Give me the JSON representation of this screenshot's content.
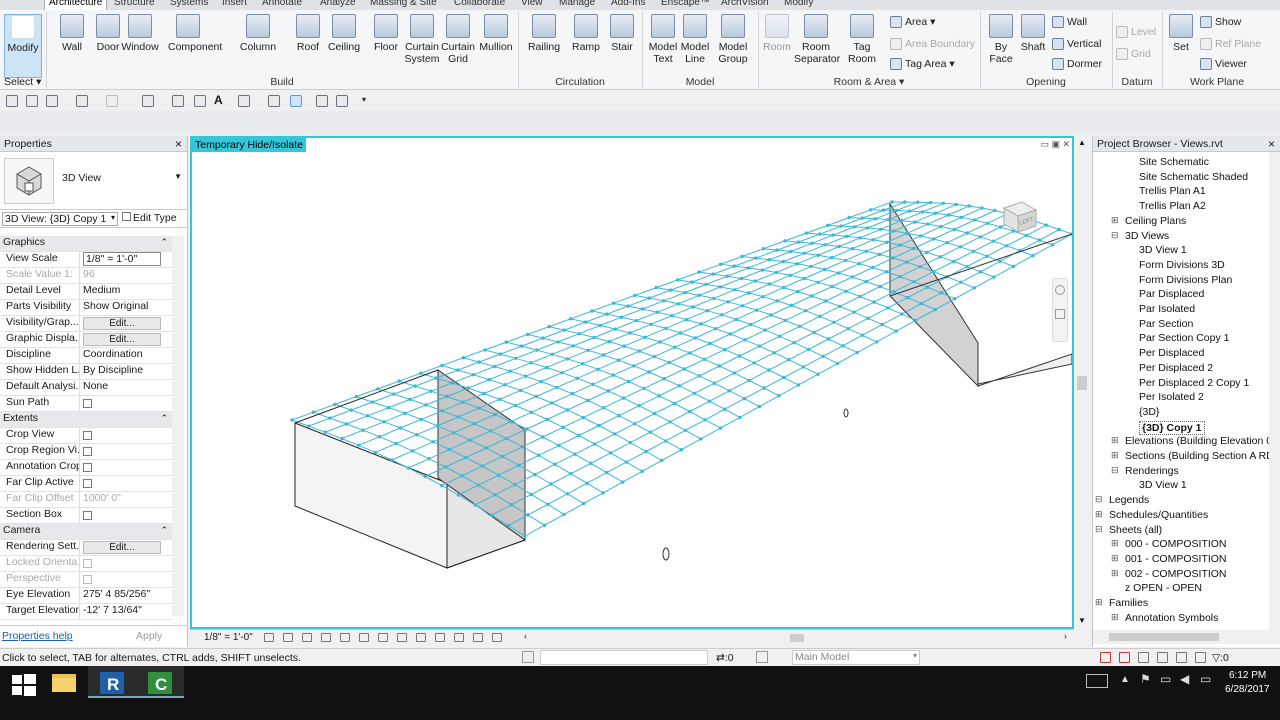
{
  "ribbon_tabs": [
    "Architecture",
    "Structure",
    "Systems",
    "Insert",
    "Annotate",
    "Analyze",
    "Massing & Site",
    "Collaborate",
    "View",
    "Manage",
    "Add-Ins",
    "Enscape™",
    "ArchVision",
    "Modify"
  ],
  "ribbon": {
    "modify": "Modify",
    "select": "Select ▾",
    "build": {
      "label": "Build",
      "items": [
        "Wall",
        "Door",
        "Window",
        "Component",
        "Column",
        "Roof",
        "Ceiling",
        "Floor",
        "Curtain System",
        "Curtain Grid",
        "Mullion"
      ]
    },
    "circulation": {
      "label": "Circulation",
      "items": [
        "Railing",
        "Ramp",
        "Stair"
      ]
    },
    "model": {
      "label": "Model",
      "items": [
        "Model Text",
        "Model Line",
        "Model Group"
      ]
    },
    "room_area": {
      "label": "Room & Area ▾",
      "items": [
        "Room",
        "Room Separator",
        "Tag Room"
      ],
      "small": [
        "Area ▾",
        "Area Boundary",
        "Tag Area ▾"
      ]
    },
    "opening": {
      "label": "Opening",
      "items": [
        "By Face",
        "Shaft"
      ],
      "small": [
        "Wall",
        "Vertical",
        "Dormer"
      ]
    },
    "datum": {
      "label": "Datum",
      "small": [
        "Level",
        "Grid"
      ]
    },
    "work_plane": {
      "label": "Work Plane",
      "items": [
        "Set"
      ],
      "small": [
        "Show",
        "Ref Plane",
        "Viewer"
      ]
    }
  },
  "properties": {
    "title": "Properties",
    "type_name": "3D View",
    "view_selector": "3D View: {3D} Copy 1",
    "edit_type": "Edit Type",
    "groups": [
      {
        "name": "Graphics",
        "rows": [
          {
            "k": "View Scale",
            "v": "1/8\" = 1'-0\"",
            "t": "input"
          },
          {
            "k": "Scale Value   1:",
            "v": "96",
            "dis": true
          },
          {
            "k": "Detail Level",
            "v": "Medium"
          },
          {
            "k": "Parts Visibility",
            "v": "Show Original"
          },
          {
            "k": "Visibility/Grap...",
            "v": "Edit...",
            "t": "btn"
          },
          {
            "k": "Graphic Displa...",
            "v": "Edit...",
            "t": "btn"
          },
          {
            "k": "Discipline",
            "v": "Coordination"
          },
          {
            "k": "Show Hidden L...",
            "v": "By Discipline"
          },
          {
            "k": "Default Analysi...",
            "v": "None"
          },
          {
            "k": "Sun Path",
            "v": "",
            "t": "cb"
          }
        ]
      },
      {
        "name": "Extents",
        "rows": [
          {
            "k": "Crop View",
            "v": "",
            "t": "cb"
          },
          {
            "k": "Crop Region Vi...",
            "v": "",
            "t": "cb"
          },
          {
            "k": "Annotation Crop",
            "v": "",
            "t": "cb"
          },
          {
            "k": "Far Clip Active",
            "v": "",
            "t": "cb"
          },
          {
            "k": "Far Clip Offset",
            "v": "1000'  0\"",
            "dis": true
          },
          {
            "k": "Section Box",
            "v": "",
            "t": "cb"
          }
        ]
      },
      {
        "name": "Camera",
        "rows": [
          {
            "k": "Rendering Sett...",
            "v": "Edit...",
            "t": "btn"
          },
          {
            "k": "Locked Orienta...",
            "v": "",
            "t": "cb",
            "dis": true
          },
          {
            "k": "Perspective",
            "v": "",
            "t": "cb",
            "dis": true
          },
          {
            "k": "Eye Elevation",
            "v": "275'  4 85/256\""
          },
          {
            "k": "Target Elevation",
            "v": "-12'  7 13/64\""
          }
        ]
      }
    ],
    "help": "Properties help",
    "apply": "Apply"
  },
  "viewport": {
    "label": "Temporary Hide/Isolate",
    "scale": "1/8\" = 1'-0\""
  },
  "project_browser": {
    "title": "Project Browser - Views.rvt",
    "nodes": [
      {
        "t": "Site Schematic",
        "d": 3
      },
      {
        "t": "Site Schematic Shaded",
        "d": 3
      },
      {
        "t": "Trellis Plan A1",
        "d": 3
      },
      {
        "t": "Trellis Plan A2",
        "d": 3
      },
      {
        "t": "Ceiling Plans",
        "d": 2,
        "ex": "⊞"
      },
      {
        "t": "3D Views",
        "d": 2,
        "ex": "⊟"
      },
      {
        "t": "3D View 1",
        "d": 3
      },
      {
        "t": "Form Divisions 3D",
        "d": 3
      },
      {
        "t": "Form Divisions Plan",
        "d": 3
      },
      {
        "t": "Par Displaced",
        "d": 3
      },
      {
        "t": "Par Isolated",
        "d": 3
      },
      {
        "t": "Par Section",
        "d": 3
      },
      {
        "t": "Par Section Copy 1",
        "d": 3
      },
      {
        "t": "Per Displaced",
        "d": 3
      },
      {
        "t": "Per Displaced 2",
        "d": 3
      },
      {
        "t": "Per Displaced 2 Copy 1",
        "d": 3
      },
      {
        "t": "Per Isolated 2",
        "d": 3
      },
      {
        "t": "{3D}",
        "d": 3
      },
      {
        "t": "{3D} Copy 1",
        "d": 3,
        "cur": true
      },
      {
        "t": "Elevations (Building Elevation 0",
        "d": 2,
        "ex": "⊞"
      },
      {
        "t": "Sections (Building Section A RD",
        "d": 2,
        "ex": "⊞"
      },
      {
        "t": "Renderings",
        "d": 2,
        "ex": "⊟"
      },
      {
        "t": "3D View 1",
        "d": 3
      },
      {
        "t": "Legends",
        "d": 1,
        "ex": "⊟"
      },
      {
        "t": "Schedules/Quantities",
        "d": 1,
        "ex": "⊞"
      },
      {
        "t": "Sheets (all)",
        "d": 1,
        "ex": "⊟"
      },
      {
        "t": "000 - COMPOSITION",
        "d": 2,
        "ex": "⊞"
      },
      {
        "t": "001 - COMPOSITION",
        "d": 2,
        "ex": "⊞"
      },
      {
        "t": "002 - COMPOSITION",
        "d": 2,
        "ex": "⊞"
      },
      {
        "t": "z OPEN - OPEN",
        "d": 2
      },
      {
        "t": "Families",
        "d": 1,
        "ex": "⊞"
      },
      {
        "t": "Annotation Symbols",
        "d": 2,
        "ex": "⊞"
      }
    ]
  },
  "status": {
    "hint": "Click to select, TAB for alternates, CTRL adds, SHIFT unselects.",
    "zero": ":0",
    "model": "Main Model",
    "filter": ":0"
  },
  "taskbar": {
    "time": "6:12 PM",
    "date": "6/28/2017"
  },
  "colors": {
    "accent": "#35c6d8",
    "grid": "#3cb8d6"
  }
}
